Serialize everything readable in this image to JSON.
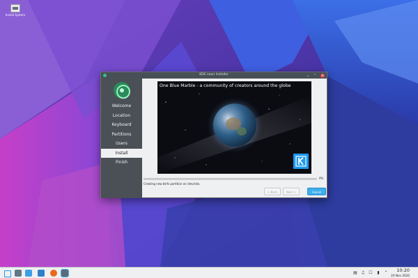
{
  "desktop": {
    "icon": {
      "name": "computer-icon",
      "label_line1": "Install System",
      "label_line2": ""
    }
  },
  "window": {
    "title": "KDE neon Installer",
    "sidebar": {
      "steps": [
        {
          "label": "Welcome",
          "active": false
        },
        {
          "label": "Location",
          "active": false
        },
        {
          "label": "Keyboard",
          "active": false
        },
        {
          "label": "Partitions",
          "active": false
        },
        {
          "label": "Users",
          "active": false
        },
        {
          "label": "Install",
          "active": true
        },
        {
          "label": "Finish",
          "active": false
        }
      ]
    },
    "slideshow": {
      "title": "One Blue Marble - a community of creators around the globe"
    },
    "progress": {
      "value": 0,
      "label": "0%"
    },
    "status": "Creating new btrfs partition on /dev/sda.",
    "buttons": {
      "back": "< Back",
      "next": "Next >",
      "cancel": "Cancel"
    }
  },
  "taskbar": {
    "tasks": [
      "application-launcher-icon",
      "settings-icon",
      "task-manager-icon",
      "file-manager-icon",
      "firefox-icon",
      "installer-icon"
    ],
    "tray": [
      "clipboard-icon",
      "volume-icon",
      "network-icon",
      "battery-icon",
      "chevron-up-icon"
    ],
    "clock": {
      "time": "10:20",
      "date": "20 Nov 2020"
    }
  },
  "colors": {
    "accent": "#3daee9",
    "sidebar": "#4a5056",
    "close": "#da4453",
    "kde_blue": "#1d99f3"
  }
}
